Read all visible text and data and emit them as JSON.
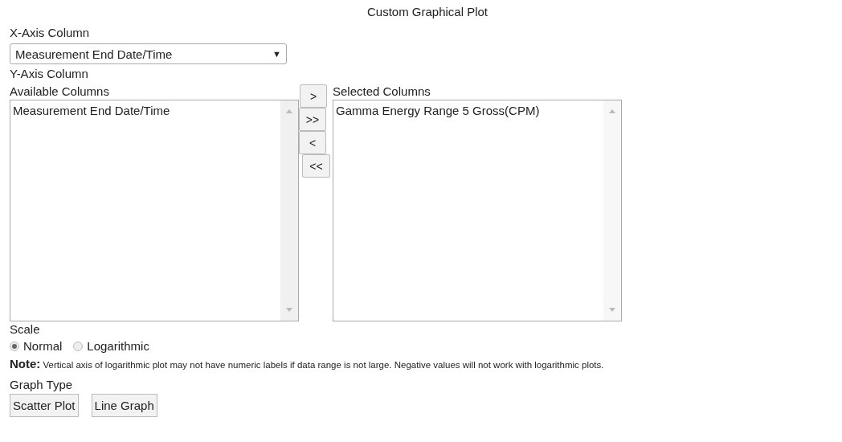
{
  "title": "Custom Graphical Plot",
  "x_axis": {
    "label": "X-Axis Column",
    "value": "Measurement End Date/Time",
    "arrow": "▼"
  },
  "y_axis": {
    "label": "Y-Axis Column",
    "available": {
      "label": "Available Columns",
      "items": [
        "Measurement End Date/Time"
      ]
    },
    "move_buttons": [
      ">",
      ">>",
      "<",
      "<<"
    ],
    "selected": {
      "label": "Selected Columns",
      "items": [
        "Gamma Energy Range 5 Gross(CPM)"
      ]
    }
  },
  "scale": {
    "label": "Scale",
    "options": [
      {
        "label": "Normal",
        "selected": true
      },
      {
        "label": "Logarithmic",
        "selected": false
      }
    ]
  },
  "note": "**Note:** Vertical axis of logarithmic plot may not have numeric labels if data range is not large. Negative values will not work with logarithmic plots.",
  "graph_type": {
    "label": "Graph Type",
    "buttons": [
      "Scatter Plot",
      "Line Graph"
    ]
  }
}
